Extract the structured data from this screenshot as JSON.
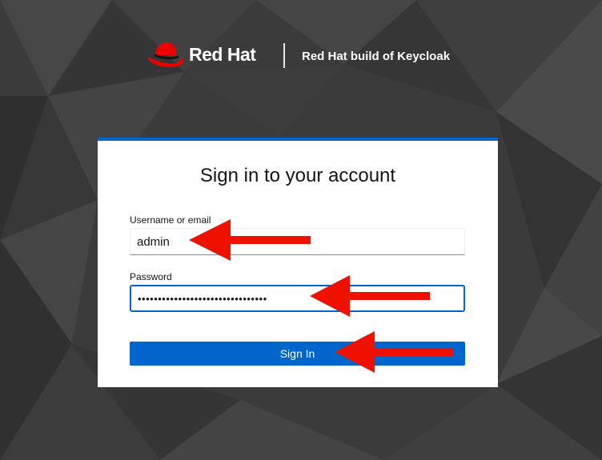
{
  "header": {
    "brand": "Red Hat",
    "product": "Red Hat build of Keycloak"
  },
  "login": {
    "title": "Sign in to your account",
    "username_label": "Username or email",
    "username_value": "admin",
    "password_label": "Password",
    "password_value": "••••••••••••••••••••••••••••••••",
    "submit_label": "Sign In"
  },
  "colors": {
    "accent": "#0066cc",
    "brand_red": "#ee0000",
    "annotation_arrow": "#ee1100",
    "background": "#3a3a3a"
  },
  "icons": [
    "red-hat-logo-icon",
    "arrow-left-annotation"
  ]
}
